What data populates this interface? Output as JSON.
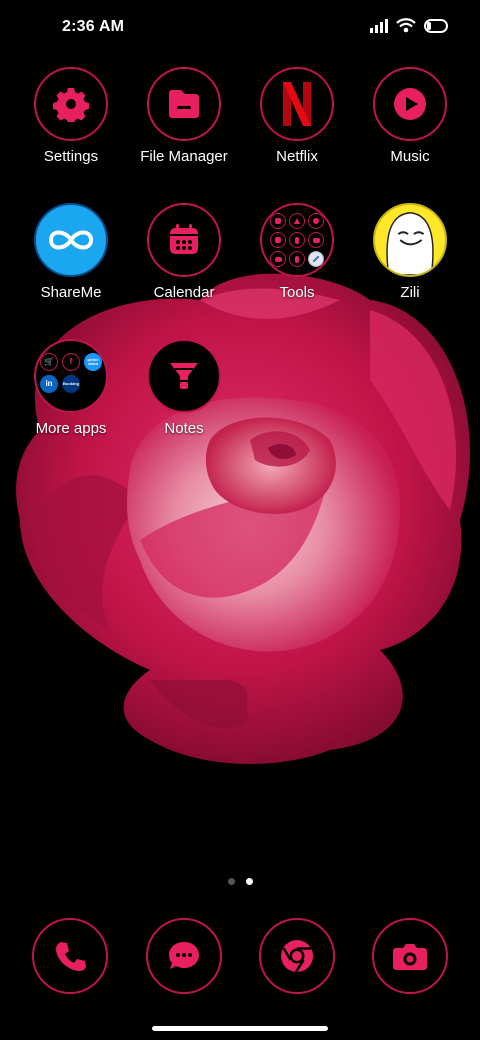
{
  "status_bar": {
    "time": "2:36 AM",
    "icons": [
      "signal-icon",
      "wifi-icon",
      "battery-icon"
    ]
  },
  "colors": {
    "accent": "#e8205f",
    "ring": "#c0154a",
    "background": "#000000",
    "netflix_red": "#e50914",
    "shareme_blue": "#1ba6f0",
    "zili_yellow": "#ffe82a"
  },
  "apps": {
    "settings": {
      "label": "Settings",
      "icon": "gear-icon"
    },
    "file_manager": {
      "label": "File Manager",
      "icon": "folder-icon"
    },
    "netflix": {
      "label": "Netflix",
      "icon": "netflix-icon"
    },
    "music": {
      "label": "Music",
      "icon": "play-icon"
    },
    "shareme": {
      "label": "ShareMe",
      "icon": "infinity-icon"
    },
    "calendar": {
      "label": "Calendar",
      "icon": "calendar-icon"
    },
    "tools": {
      "label": "Tools",
      "icon": "folder-grid-icon"
    },
    "zili": {
      "label": "Zili",
      "icon": "zili-face-icon"
    },
    "more_apps": {
      "label": "More apps",
      "chips": [
        "",
        "f",
        "prime video",
        "in",
        "Booking"
      ]
    },
    "notes": {
      "label": "Notes",
      "icon": "notes-icon"
    }
  },
  "page_indicator": {
    "pages": 2,
    "current": 2
  },
  "dock": [
    {
      "name": "phone",
      "icon": "phone-icon"
    },
    {
      "name": "messages",
      "icon": "chat-icon"
    },
    {
      "name": "chrome",
      "icon": "chrome-icon"
    },
    {
      "name": "camera",
      "icon": "camera-icon"
    }
  ]
}
